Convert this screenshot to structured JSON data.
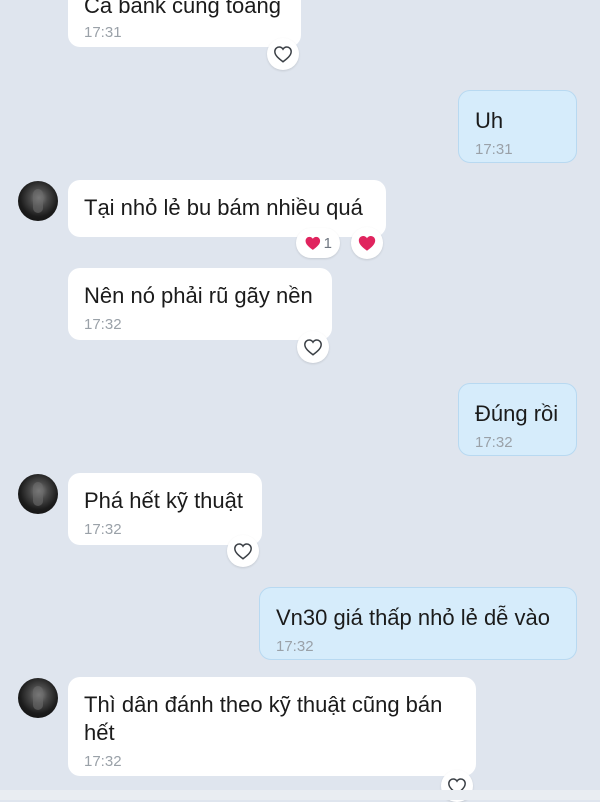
{
  "messages": [
    {
      "text": "Cả bank cũng toang",
      "time": "17:31"
    },
    {
      "text": "Uh",
      "time": "17:31"
    },
    {
      "text": "Tại nhỏ lẻ bu bám nhiều quá"
    },
    {
      "text": "Nên nó phải rũ gãy nền",
      "time": "17:32"
    },
    {
      "text": "Đúng rồi",
      "time": "17:32"
    },
    {
      "text": "Phá hết kỹ thuật",
      "time": "17:32"
    },
    {
      "text": "Vn30 giá thấp nhỏ lẻ dễ vào",
      "time": "17:32"
    },
    {
      "text": "Thì dân đánh theo kỹ thuật cũng bán hết",
      "time": "17:32"
    }
  ],
  "reactions": {
    "heart_count": "1"
  },
  "colors": {
    "heart": "#e0245e",
    "outgoing_bubble": "#d6ecfb",
    "incoming_bubble": "#ffffff",
    "background": "#dfe5ee"
  }
}
